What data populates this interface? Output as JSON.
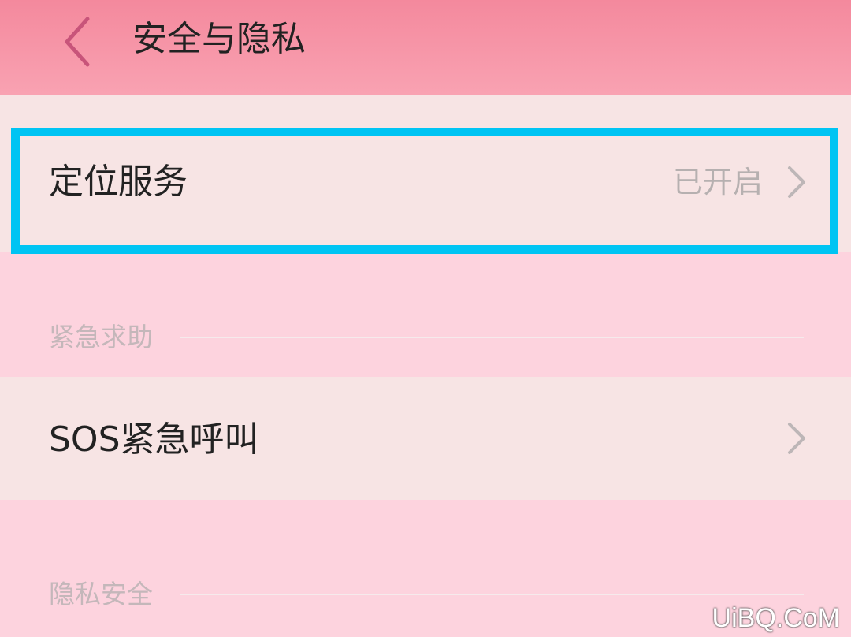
{
  "header": {
    "title": "安全与隐私",
    "back_icon": "chevron-left-icon"
  },
  "items": {
    "location": {
      "label": "定位服务",
      "value": "已开启",
      "highlight_color": "#00c4f3"
    },
    "sos": {
      "label": "SOS紧急呼叫"
    }
  },
  "sections": {
    "emergency": "紧急求助",
    "privacy": "隐私安全"
  },
  "watermark": "UiBQ.CoM",
  "colors": {
    "header_start": "#f4899d",
    "header_end": "#f9a2b2",
    "row_bg": "#f7e4e4",
    "page_bg": "#fdd3de",
    "back_icon": "#c8547a",
    "chevron": "#bdb6b7"
  }
}
